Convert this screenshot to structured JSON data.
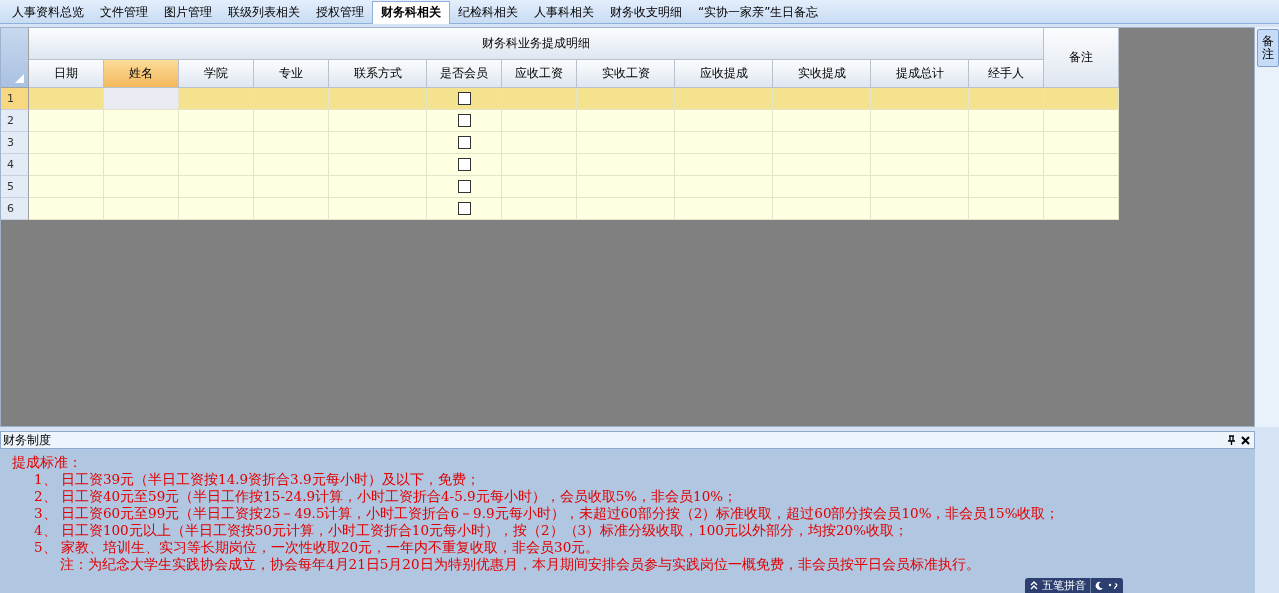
{
  "tabs": [
    {
      "label": "人事资料总览",
      "selected": false
    },
    {
      "label": "文件管理",
      "selected": false
    },
    {
      "label": "图片管理",
      "selected": false
    },
    {
      "label": "联级列表相关",
      "selected": false
    },
    {
      "label": "授权管理",
      "selected": false
    },
    {
      "label": "财务科相关",
      "selected": true
    },
    {
      "label": "纪检科相关",
      "selected": false
    },
    {
      "label": "人事科相关",
      "selected": false
    },
    {
      "label": "财务收支明细",
      "selected": false
    },
    {
      "label": "“实协一家亲”生日备忘",
      "selected": false
    }
  ],
  "grid": {
    "group_title": "财务科业务提成明细",
    "columns": [
      {
        "label": "日期",
        "selected": false
      },
      {
        "label": "姓名",
        "selected": true
      },
      {
        "label": "学院",
        "selected": false
      },
      {
        "label": "专业",
        "selected": false
      },
      {
        "label": "联系方式",
        "selected": false
      },
      {
        "label": "是否会员",
        "selected": false
      },
      {
        "label": "应收工资",
        "selected": false
      },
      {
        "label": "实收工资",
        "selected": false
      },
      {
        "label": "应收提成",
        "selected": false
      },
      {
        "label": "实收提成",
        "selected": false
      },
      {
        "label": "提成总计",
        "selected": false
      },
      {
        "label": "经手人",
        "selected": false
      }
    ],
    "remark_column": "备注",
    "rows": [
      {
        "number": "1",
        "selected": true,
        "member": false
      },
      {
        "number": "2",
        "selected": false,
        "member": false
      },
      {
        "number": "3",
        "selected": false,
        "member": false
      },
      {
        "number": "4",
        "selected": false,
        "member": false
      },
      {
        "number": "5",
        "selected": false,
        "member": false
      },
      {
        "number": "6",
        "selected": false,
        "member": false
      }
    ]
  },
  "side_tab": "备注",
  "panel": {
    "title": "财务制度",
    "lines": [
      {
        "kind": "heading",
        "text": "提成标准："
      },
      {
        "kind": "item",
        "text": "1、 日工资39元（半日工资按14.9资折合3.9元每小时）及以下，免费；"
      },
      {
        "kind": "item",
        "text": "2、 日工资40元至59元（半日工作按15-24.9计算，小时工资折合4-5.9元每小时），会员收取5%，非会员10%；"
      },
      {
        "kind": "item",
        "text": "3、 日工资60元至99元（半日工资按25－49.5计算，小时工资折合6－9.9元每小时），未超过60部分按（2）标准收取，超过60部分按会员10%，非会员15%收取；"
      },
      {
        "kind": "item",
        "text": "4、 日工资100元以上（半日工资按50元计算，小时工资折合10元每小时），按（2）（3）标准分级收取，100元以外部分，均按20%收取；"
      },
      {
        "kind": "item",
        "text": "5、 家教、培训生、实习等长期岗位，一次性收取20元，一年内不重复收取，非会员30元。"
      },
      {
        "kind": "note",
        "text": "注：为纪念大学生实践协会成立，协会每年4月21日5月20日为特别优惠月，本月期间安排会员参与实践岗位一概免费，非会员按平日会员标准执行。"
      }
    ]
  },
  "ime": {
    "label": "五笔拼音"
  }
}
